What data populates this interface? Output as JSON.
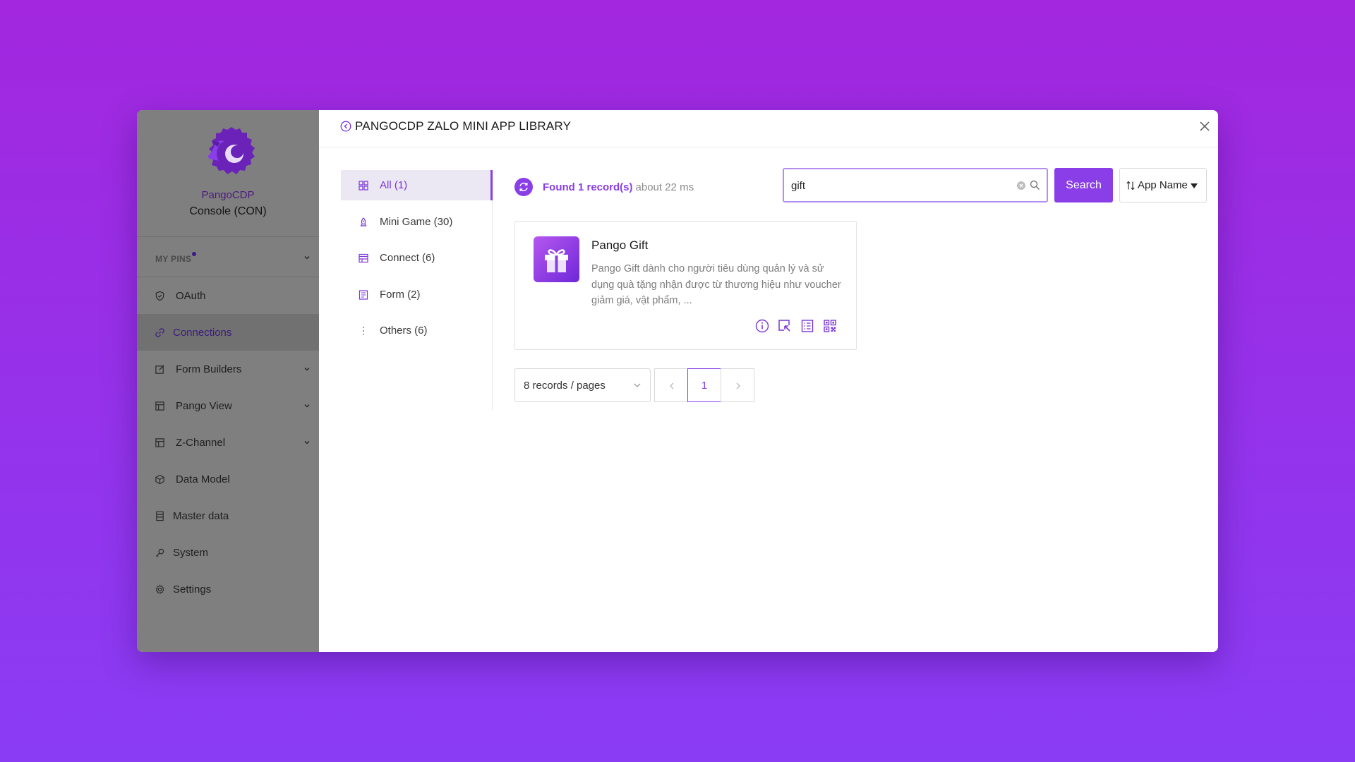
{
  "sidebar": {
    "brand_name": "PangoCDP",
    "brand_sub": "Console (CON)",
    "pins_label": "MY PINS",
    "items": [
      {
        "label": "OAuth",
        "icon": "shield-icon"
      },
      {
        "label": "Connections",
        "icon": "link-icon",
        "active": true
      },
      {
        "label": "Form Builders",
        "icon": "edit-icon",
        "expandable": true
      },
      {
        "label": "Pango View",
        "icon": "layout-icon",
        "expandable": true
      },
      {
        "label": "Z-Channel",
        "icon": "layout-icon",
        "expandable": true
      },
      {
        "label": "Data Model",
        "icon": "cube-icon"
      },
      {
        "label": "Master data",
        "icon": "table-icon"
      },
      {
        "label": "System",
        "icon": "key-icon"
      },
      {
        "label": "Settings",
        "icon": "gear-icon"
      }
    ]
  },
  "header": {
    "title": "PANGOCDP ZALO MINI APP LIBRARY"
  },
  "categories": [
    {
      "label": "All (1)",
      "icon": "grid-icon",
      "active": true
    },
    {
      "label": "Mini Game (30)",
      "icon": "rocket-icon"
    },
    {
      "label": "Connect (6)",
      "icon": "window-icon"
    },
    {
      "label": "Form (2)",
      "icon": "form-icon"
    },
    {
      "label": "Others (6)",
      "icon": "more-icon"
    }
  ],
  "results": {
    "found_text": "Found 1 record(s)",
    "time_text": "about 22 ms"
  },
  "search": {
    "value": "gift",
    "button_label": "Search",
    "sort_label": "App Name"
  },
  "apps": [
    {
      "name": "Pango Gift",
      "description": "Pango Gift dành cho người tiêu dùng quản lý và sử dụng quà tặng nhận được từ thương hiệu như voucher giảm giá, vật phẩm, ...",
      "icon": "gift-icon"
    }
  ],
  "pagination": {
    "page_size_label": "8 records / pages",
    "current_page": "1"
  },
  "colors": {
    "accent": "#8a3ee8",
    "background_top": "#a227de",
    "background_bottom": "#8a3cf5",
    "sidebar": "#7f7f7f"
  }
}
